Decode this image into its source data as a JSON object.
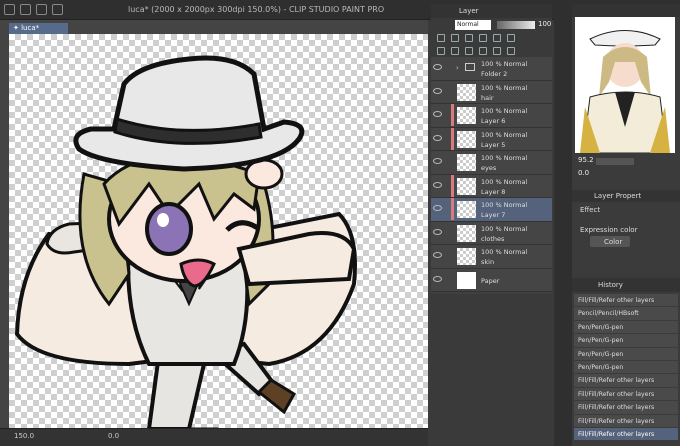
{
  "window": {
    "title": "luca* (2000 x 2000px 300dpi 150.0%)  - CLIP STUDIO PAINT PRO"
  },
  "canvas_tab": {
    "label": "✦ luca*"
  },
  "status": {
    "zoom": "150.0",
    "angle": "0.0"
  },
  "layer_panel": {
    "title": "Layer",
    "blend_mode": "Normal",
    "opacity": "100",
    "layers": [
      {
        "mode": "100 % Normal",
        "name": "Folder 2",
        "type": "folder",
        "clip": false,
        "selected": false
      },
      {
        "mode": "100 % Normal",
        "name": "hair",
        "type": "raster",
        "clip": false,
        "selected": false
      },
      {
        "mode": "100 % Normal",
        "name": "Layer 6",
        "type": "raster",
        "clip": true,
        "selected": false
      },
      {
        "mode": "100 % Normal",
        "name": "Layer 5",
        "type": "raster",
        "clip": true,
        "selected": false
      },
      {
        "mode": "100 % Normal",
        "name": "eyes",
        "type": "raster",
        "clip": false,
        "selected": false
      },
      {
        "mode": "100 % Normal",
        "name": "Layer 8",
        "type": "raster",
        "clip": true,
        "selected": false
      },
      {
        "mode": "100 % Normal",
        "name": "Layer 7",
        "type": "raster",
        "clip": true,
        "selected": true
      },
      {
        "mode": "100 % Normal",
        "name": "clothes",
        "type": "raster",
        "clip": false,
        "selected": false
      },
      {
        "mode": "100 % Normal",
        "name": "skin",
        "type": "raster",
        "clip": false,
        "selected": false
      },
      {
        "mode": "",
        "name": "Paper",
        "type": "paper",
        "clip": false,
        "selected": false
      }
    ]
  },
  "navigator": {
    "zoom": "95.2",
    "rotation": "0.0"
  },
  "layer_property": {
    "title": "Layer Propert",
    "effect_label": "Effect",
    "expression_label": "Expression color",
    "expression_value": "Color"
  },
  "history": {
    "title": "History",
    "items": [
      "Fill/Fill/Refer other layers",
      "Pencil/Pencil/HBsoft",
      "Pen/Pen/G-pen",
      "Pen/Pen/G-pen",
      "Pen/Pen/G-pen",
      "Pen/Pen/G-pen",
      "Fill/Fill/Refer other layers",
      "Fill/Fill/Refer other layers",
      "Fill/Fill/Refer other layers",
      "Fill/Fill/Refer other layers",
      "Fill/Fill/Refer other layers"
    ],
    "selected_index": 10
  },
  "colors": {
    "accent": "#55627c",
    "clip_marker": "#d97b7b"
  }
}
